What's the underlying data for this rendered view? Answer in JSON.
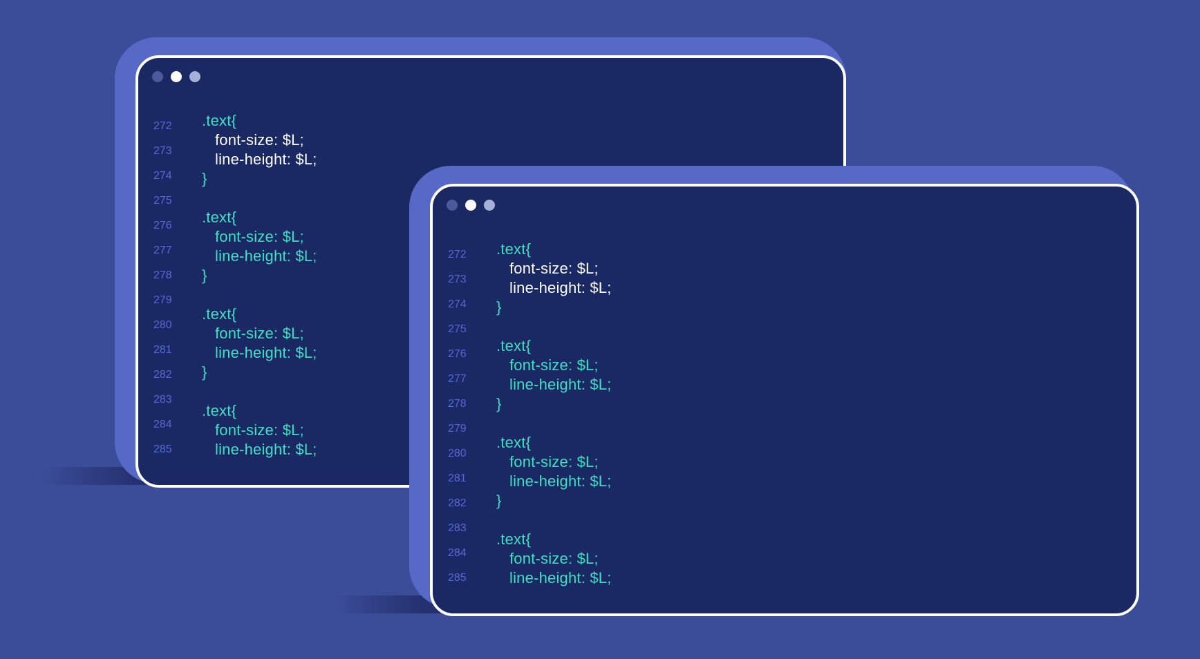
{
  "colors": {
    "background": "#3b4d98",
    "plate": "#5669c6",
    "window": "#1a2864",
    "window_border": "#ffffff",
    "line_number": "#5a6ad0",
    "code_teal": "#3ee0c0",
    "code_white": "#ffffff",
    "dot_dim": "#5a6aa8",
    "dot_bright": "#ffffff",
    "dot_mid": "#a7b0d6"
  },
  "windows": [
    {
      "name": "back-editor",
      "dots": [
        "dot-dim",
        "dot-bright",
        "dot-mid"
      ],
      "lines": [
        {
          "num": "272",
          "text": ".text{",
          "indent": 0,
          "color": "teal"
        },
        {
          "num": "273",
          "text": "font-size: $L;",
          "indent": 1,
          "color": "white"
        },
        {
          "num": "274",
          "text": "line-height: $L;",
          "indent": 1,
          "color": "white"
        },
        {
          "num": "",
          "text": "}",
          "indent": 0,
          "color": "teal"
        },
        {
          "num": "275",
          "text": "",
          "indent": 0,
          "color": "teal"
        },
        {
          "num": "276",
          "text": ".text{",
          "indent": 0,
          "color": "teal"
        },
        {
          "num": "277",
          "text": "font-size: $L;",
          "indent": 1,
          "color": "teal"
        },
        {
          "num": "278",
          "text": "line-height: $L;",
          "indent": 1,
          "color": "teal"
        },
        {
          "num": "",
          "text": "}",
          "indent": 0,
          "color": "teal"
        },
        {
          "num": "279",
          "text": "",
          "indent": 0,
          "color": "teal"
        },
        {
          "num": "280",
          "text": ".text{",
          "indent": 0,
          "color": "teal"
        },
        {
          "num": "281",
          "text": "font-size: $L;",
          "indent": 1,
          "color": "teal"
        },
        {
          "num": "282",
          "text": "line-height: $L;",
          "indent": 1,
          "color": "teal"
        },
        {
          "num": "",
          "text": "}",
          "indent": 0,
          "color": "teal"
        },
        {
          "num": "283",
          "text": "",
          "indent": 0,
          "color": "teal"
        },
        {
          "num": "284",
          "text": ".text{",
          "indent": 0,
          "color": "teal"
        },
        {
          "num": "285",
          "text": "font-size: $L;",
          "indent": 1,
          "color": "teal"
        },
        {
          "num": "",
          "text": "line-height: $L;",
          "indent": 1,
          "color": "teal"
        }
      ]
    },
    {
      "name": "front-editor",
      "dots": [
        "dot-dim",
        "dot-bright",
        "dot-mid"
      ],
      "lines": [
        {
          "num": "272",
          "text": ".text{",
          "indent": 0,
          "color": "teal"
        },
        {
          "num": "273",
          "text": "font-size: $L;",
          "indent": 1,
          "color": "white"
        },
        {
          "num": "274",
          "text": "line-height: $L;",
          "indent": 1,
          "color": "white"
        },
        {
          "num": "",
          "text": "}",
          "indent": 0,
          "color": "teal"
        },
        {
          "num": "275",
          "text": "",
          "indent": 0,
          "color": "teal"
        },
        {
          "num": "276",
          "text": ".text{",
          "indent": 0,
          "color": "teal"
        },
        {
          "num": "277",
          "text": "font-size: $L;",
          "indent": 1,
          "color": "teal"
        },
        {
          "num": "278",
          "text": "line-height: $L;",
          "indent": 1,
          "color": "teal"
        },
        {
          "num": "",
          "text": "}",
          "indent": 0,
          "color": "teal"
        },
        {
          "num": "279",
          "text": "",
          "indent": 0,
          "color": "teal"
        },
        {
          "num": "280",
          "text": ".text{",
          "indent": 0,
          "color": "teal"
        },
        {
          "num": "281",
          "text": "font-size: $L;",
          "indent": 1,
          "color": "teal"
        },
        {
          "num": "282",
          "text": "line-height: $L;",
          "indent": 1,
          "color": "teal"
        },
        {
          "num": "",
          "text": "}",
          "indent": 0,
          "color": "teal"
        },
        {
          "num": "283",
          "text": "",
          "indent": 0,
          "color": "teal"
        },
        {
          "num": "284",
          "text": ".text{",
          "indent": 0,
          "color": "teal"
        },
        {
          "num": "285",
          "text": "font-size: $L;",
          "indent": 1,
          "color": "teal"
        },
        {
          "num": "",
          "text": "line-height: $L;",
          "indent": 1,
          "color": "teal"
        }
      ]
    }
  ]
}
